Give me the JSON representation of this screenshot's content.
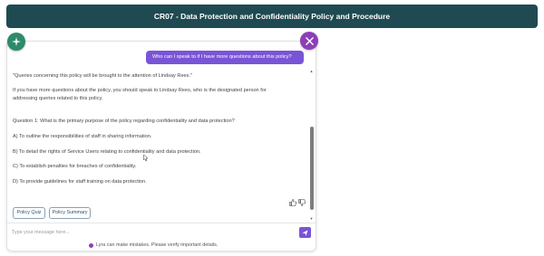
{
  "header": {
    "title": "CR07 - Data Protection and Confidentiality Policy and Procedure"
  },
  "chat": {
    "user_message": "Who can I speak to if I have more questions about this policy?",
    "bot_lines": [
      "\"Queries concerning this policy will be brought to the attention of Lindsay Rees.\"",
      "If you have more questions about the policy, you should speak to Lindsay Rees, who is the designated person for",
      "addressing queries related to this policy.",
      "Question 1: What is the primary purpose of the policy regarding confidentiality and data protection?",
      "A) To outline the responsibilities of staff in sharing information.",
      "B) To detail the rights of Service Users relating to confidentiality and data protection.",
      "C) To establish penalties for breaches of confidentiality.",
      "D) To provide guidelines for staff training on data protection."
    ]
  },
  "suggestions": [
    "Policy Quiz",
    "Policy Summary"
  ],
  "input": {
    "placeholder": "Type your message here..."
  },
  "disclaimer": "Lyra can make mistakes. Please verify important details.",
  "colors": {
    "header": "#1f4a52",
    "accent": "#7a54d6",
    "close": "#8c3fb8",
    "logo": "#2e8b6a"
  },
  "icons": {
    "logo": "sparkle-icon",
    "close": "close-icon",
    "send": "send-icon",
    "like": "thumbs-up-icon",
    "dislike": "thumbs-down-icon"
  }
}
